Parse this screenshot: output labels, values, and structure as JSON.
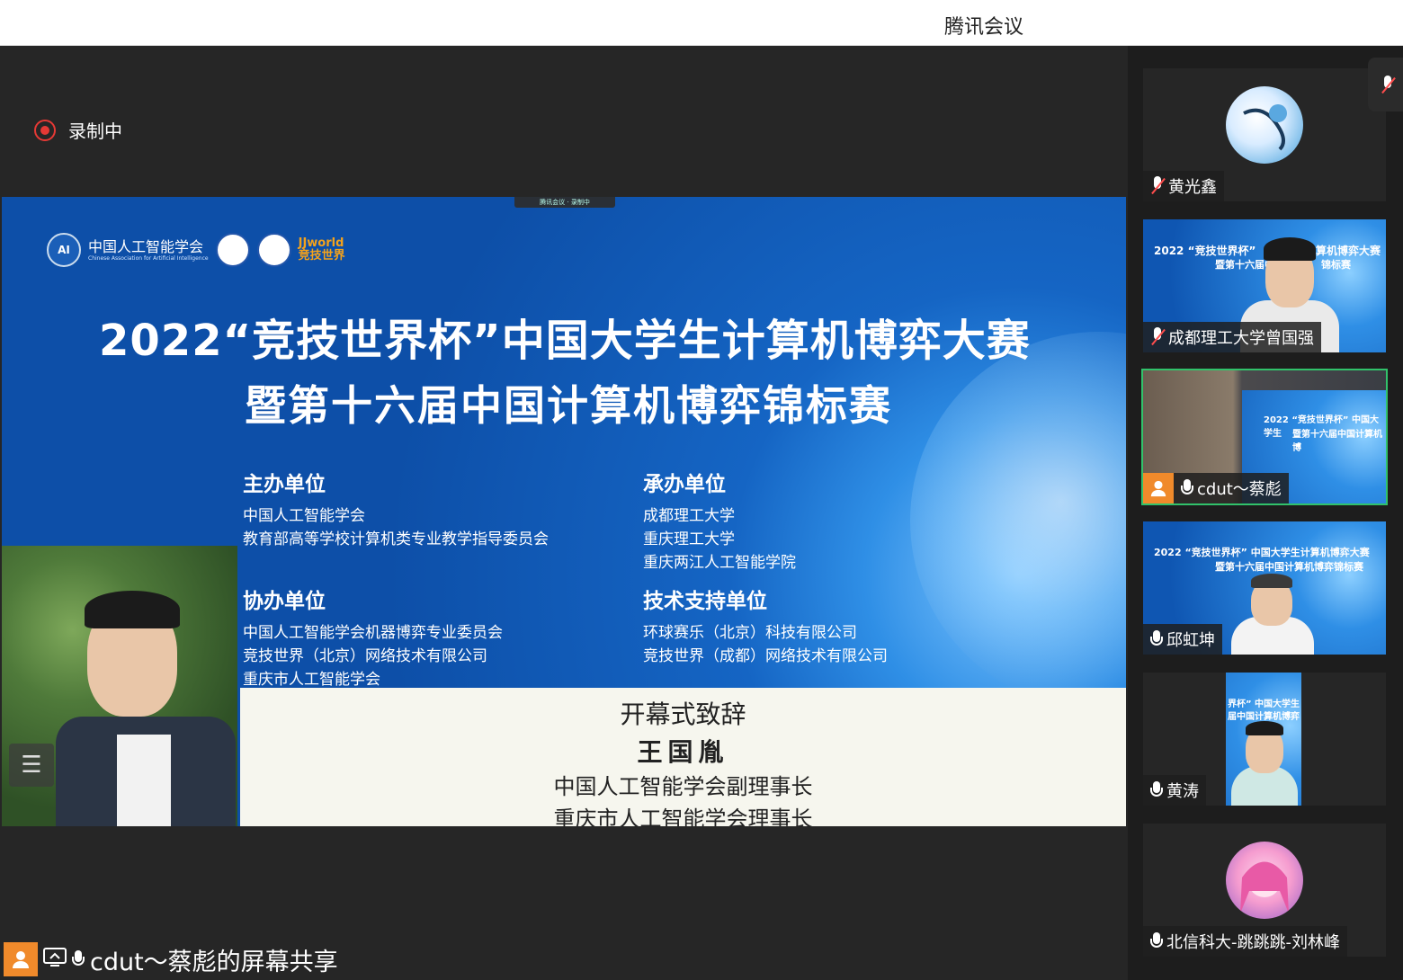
{
  "window": {
    "title": "腾讯会议"
  },
  "recording": {
    "label": "录制中"
  },
  "slide": {
    "topbar": "腾讯会议 · 录制中",
    "org_logo_text": "中国人工智能学会",
    "org_logo_sub": "Chinese Association for Artificial Intelligence",
    "brand_logo_text": "JJworld",
    "brand_logo_cn": "竞技世界",
    "title_line1": "2022“竞技世界杯”中国大学生计算机博弈大赛",
    "title_line2": "暨第十六届中国计算机博弈锦标赛",
    "host": {
      "heading": "主办单位",
      "items": [
        "中国人工智能学会",
        "教育部高等学校计算机类专业教学指导委员会"
      ]
    },
    "organizer": {
      "heading": "承办单位",
      "items": [
        "成都理工大学",
        "重庆理工大学",
        "重庆两江人工智能学院"
      ]
    },
    "co_organizer": {
      "heading": "协办单位",
      "items": [
        "中国人工智能学会机器博弈专业委员会",
        "竞技世界（北京）网络技术有限公司",
        "重庆市人工智能学会"
      ]
    },
    "tech_support": {
      "heading": "技术支持单位",
      "items": [
        "环球赛乐（北京）科技有限公司",
        "竞技世界（成都）网络技术有限公司"
      ]
    },
    "caption": {
      "line1": "开幕式致辞",
      "line2": "王国胤",
      "line3": "中国人工智能学会副理事长",
      "line4": "重庆市人工智能学会理事长"
    }
  },
  "share_tag": {
    "label": "cdut～蔡彪的屏幕共享"
  },
  "participants": [
    {
      "name": "黄光鑫",
      "muted": true
    },
    {
      "name": "成都理工大学曾国强",
      "muted": true,
      "slide_l1": "2022 “竞技世界杯”",
      "slide_l1b": "计算机博弈大赛",
      "slide_l2": "暨第十六届中",
      "slide_l2b": "锦标赛"
    },
    {
      "name": "cdut～蔡彪",
      "muted": false,
      "active": true,
      "slide_l1": "2022 “竞技世界杯” 中国大学生",
      "slide_l2": "暨第十六届中国计算机博"
    },
    {
      "name": "邱虹坤",
      "muted": false,
      "slide_l1": "2022 “竞技世界杯” 中国大学生计算机博弈大赛",
      "slide_l2": "暨第十六届中国计算机博弈锦标赛"
    },
    {
      "name": "黄涛",
      "muted": false,
      "slide_l1": "界杯” 中国大学生",
      "slide_l2": "届中国计算机博弈"
    },
    {
      "name": "北信科大-跳跳跳-刘林峰",
      "muted": false
    }
  ],
  "colors": {
    "accent_green": "#31c26b",
    "record_red": "#e53935",
    "avatar_orange": "#f08a2b"
  }
}
